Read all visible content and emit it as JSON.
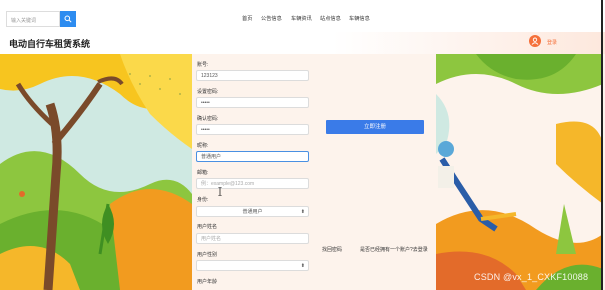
{
  "search": {
    "placeholder": "输入关键词"
  },
  "nav": [
    {
      "label": "首页"
    },
    {
      "label": "公告信息"
    },
    {
      "label": "车辆资讯"
    },
    {
      "label": "站点信息"
    },
    {
      "label": "车辆信息"
    }
  ],
  "header": {
    "title": "电动自行车租赁系统",
    "login_label": "登录"
  },
  "form": {
    "account_label": "账号:",
    "account_value": "123123",
    "password_label": "设置密码:",
    "password_value": "•••••",
    "confirm_label": "确认密码:",
    "confirm_value": "•••••",
    "nickname_label": "昵称:",
    "nickname_value": "普通用户",
    "email_label": "邮箱:",
    "email_placeholder": "例：example@123.com",
    "identity_label": "身份:",
    "identity_value": "普通用户",
    "username_label": "用户姓名",
    "username_placeholder": "用户姓名",
    "gender_label": "用户性别",
    "age_label": "用户年龄"
  },
  "register_button": "立即注册",
  "links": {
    "forgot": "找回密码",
    "have_account": "是否已经拥有一个账户?去登录"
  },
  "watermark": "CSDN @vx_1_CXKF10088",
  "colors": {
    "primary": "#3a7be8",
    "accent": "#f5703a"
  }
}
